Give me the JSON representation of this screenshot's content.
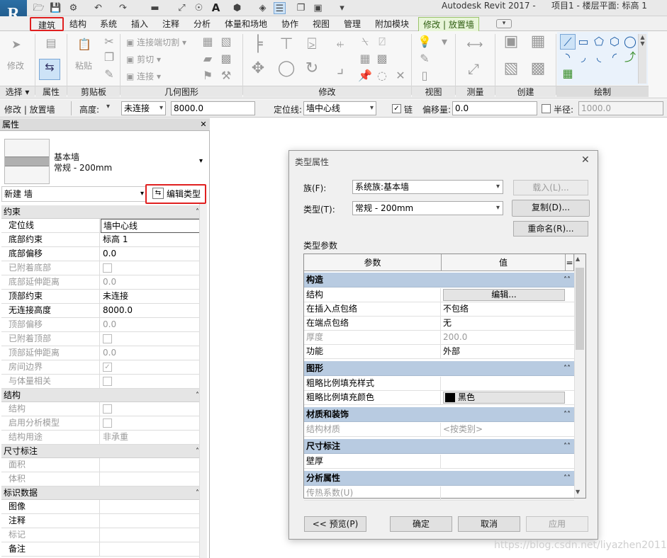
{
  "titlebar": {
    "app_letter": "R",
    "app_title": "Autodesk Revit 2017 -",
    "project_title": "项目1 - 楼层平面: 标高 1",
    "qat_text_icon": "A"
  },
  "tabs": [
    "建筑",
    "结构",
    "系统",
    "插入",
    "注释",
    "分析",
    "体量和场地",
    "协作",
    "视图",
    "管理",
    "附加模块",
    "修改 | 放置墙"
  ],
  "ribbon": {
    "modify_label": "修改",
    "paste_label": "粘贴",
    "geom_items": [
      "连接端切割",
      "剪切",
      "连接"
    ],
    "panels": [
      "选择",
      "属性",
      "剪贴板",
      "几何图形",
      "修改",
      "视图",
      "测量",
      "创建",
      "绘制"
    ]
  },
  "optionsbar": {
    "context": "修改 | 放置墙",
    "height_label": "高度:",
    "height_mode": "未连接",
    "height_value": "8000.0",
    "location_label": "定位线:",
    "location_value": "墙中心线",
    "chain_label": "链",
    "offset_label": "偏移量:",
    "offset_value": "0.0",
    "radius_label": "半径:",
    "radius_value": "1000.0"
  },
  "properties": {
    "header": "属性",
    "type_family": "基本墙",
    "type_name": "常规 - 200mm",
    "instance_label": "新建 墙",
    "edit_type_label": "编辑类型",
    "groups": [
      {
        "name": "约束",
        "rows": [
          {
            "name": "定位线",
            "value": "墙中心线",
            "gray": false
          },
          {
            "name": "底部约束",
            "value": "标高 1",
            "gray": false
          },
          {
            "name": "底部偏移",
            "value": "0.0",
            "gray": false
          },
          {
            "name": "已附着底部",
            "value": "",
            "gray": true,
            "check": true
          },
          {
            "name": "底部延伸距离",
            "value": "0.0",
            "gray": true
          },
          {
            "name": "顶部约束",
            "value": "未连接",
            "gray": false
          },
          {
            "name": "无连接高度",
            "value": "8000.0",
            "gray": false
          },
          {
            "name": "顶部偏移",
            "value": "0.0",
            "gray": true
          },
          {
            "name": "已附着顶部",
            "value": "",
            "gray": true,
            "check": true
          },
          {
            "name": "顶部延伸距离",
            "value": "0.0",
            "gray": true
          },
          {
            "name": "房间边界",
            "value": "",
            "gray": true,
            "check": true,
            "checked": true
          },
          {
            "name": "与体量相关",
            "value": "",
            "gray": true,
            "check": true
          }
        ]
      },
      {
        "name": "结构",
        "rows": [
          {
            "name": "结构",
            "value": "",
            "gray": true,
            "check": true
          },
          {
            "name": "启用分析模型",
            "value": "",
            "gray": true,
            "check": true
          },
          {
            "name": "结构用途",
            "value": "非承重",
            "gray": true
          }
        ]
      },
      {
        "name": "尺寸标注",
        "rows": [
          {
            "name": "面积",
            "value": "",
            "gray": true
          },
          {
            "name": "体积",
            "value": "",
            "gray": true
          }
        ]
      },
      {
        "name": "标识数据",
        "rows": [
          {
            "name": "图像",
            "value": "",
            "gray": false
          },
          {
            "name": "注释",
            "value": "",
            "gray": false
          },
          {
            "name": "标记",
            "value": "",
            "gray": true
          },
          {
            "name": "备注",
            "value": "",
            "gray": false
          }
        ]
      }
    ]
  },
  "dialog": {
    "title": "类型属性",
    "family_label": "族(F):",
    "family_value": "系统族:基本墙",
    "type_label": "类型(T):",
    "type_value": "常规 - 200mm",
    "load_btn": "载入(L)...",
    "duplicate_btn": "复制(D)...",
    "rename_btn": "重命名(R)...",
    "params_label": "类型参数",
    "col_param": "参数",
    "col_value": "值",
    "col_eq": "=",
    "groups": [
      {
        "name": "构造",
        "rows": [
          {
            "name": "结构",
            "value": "编辑...",
            "button": true
          },
          {
            "name": "在插入点包络",
            "value": "不包络"
          },
          {
            "name": "在端点包络",
            "value": "无"
          },
          {
            "name": "厚度",
            "value": "200.0",
            "gray": true
          },
          {
            "name": "功能",
            "value": "外部"
          }
        ]
      },
      {
        "name": "图形",
        "rows": [
          {
            "name": "粗略比例填充样式",
            "value": ""
          },
          {
            "name": "粗略比例填充颜色",
            "value": "黑色",
            "swatch": "#000000"
          }
        ]
      },
      {
        "name": "材质和装饰",
        "rows": [
          {
            "name": "结构材质",
            "value": "<按类别>",
            "gray": true
          }
        ]
      },
      {
        "name": "尺寸标注",
        "rows": [
          {
            "name": "壁厚",
            "value": ""
          }
        ]
      },
      {
        "name": "分析属性",
        "rows": [
          {
            "name": "传热系数(U)",
            "value": "",
            "gray": true
          }
        ]
      }
    ],
    "preview_btn": "<< 预览(P)",
    "ok_btn": "确定",
    "cancel_btn": "取消",
    "apply_btn": "应用"
  },
  "watermark": "https://blog.csdn.net/liyazhen2011"
}
